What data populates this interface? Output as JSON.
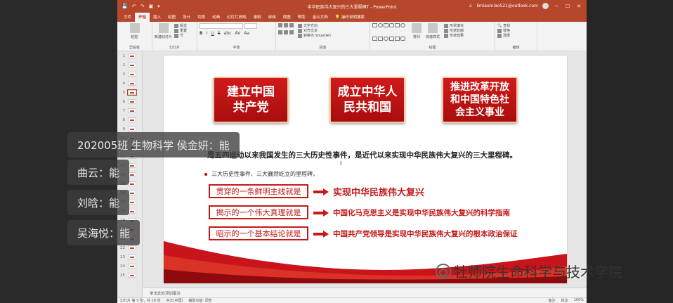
{
  "window": {
    "title": "中华民族伟大复兴的三大里程碑T - PowerPoint",
    "account": "limiaomiao521@outlook.com",
    "quick_access": [
      "💾",
      "↶",
      "↷",
      "▣",
      "▾"
    ],
    "controls": [
      "─",
      "☐",
      "✕"
    ]
  },
  "tabs": [
    "文件",
    "开始",
    "插入",
    "绘图",
    "设计",
    "切换",
    "动画",
    "幻灯片放映",
    "录制",
    "审阅",
    "视图",
    "帮助",
    "金山文档",
    "操作说明搜索"
  ],
  "active_tab": "开始",
  "ribbon": {
    "groups": [
      {
        "label": "剪贴板",
        "items": [
          "粘贴"
        ]
      },
      {
        "label": "幻灯片",
        "items": [
          "新建幻灯片",
          "版式",
          "重置",
          "节"
        ]
      },
      {
        "label": "字体",
        "items": [
          "B",
          "I",
          "U",
          "S",
          "abc",
          "AV",
          "Aa"
        ]
      },
      {
        "label": "段落",
        "items": [
          "文字方向",
          "对齐文本",
          "转换为 SmartArt"
        ]
      },
      {
        "label": "绘图",
        "items": [
          "排列",
          "快速样式",
          "形状填充",
          "形状轮廓",
          "形状效果"
        ]
      },
      {
        "label": "编辑",
        "items": [
          "查找",
          "替换",
          "选择"
        ]
      }
    ]
  },
  "thumbnails": {
    "numbers": [
      "1",
      "2",
      "3",
      "4",
      "5",
      "6",
      "7",
      "8",
      "9",
      "10",
      "11",
      "12",
      "13",
      "14",
      "15",
      "16",
      "17",
      "18",
      "19",
      "20",
      "21",
      "22",
      "23",
      "24",
      "25"
    ],
    "selected": "5"
  },
  "slide": {
    "boxes": [
      {
        "text": "建立中国\n共产党"
      },
      {
        "text": "成立中华人\n民共和国"
      },
      {
        "text": "推进改革开放\n和中国特色社\n会主义事业"
      }
    ],
    "main_line": "是五四运动以来我国发生的三大历史性事件，是近代以来实现中华民族伟大复兴的三大里程碑。",
    "bullet": "三大历史性事件、三大巍然屹立的里程碑，",
    "rows": [
      {
        "label": "贯穿的一条鲜明主线就是",
        "text": "实现中华民族伟大复兴"
      },
      {
        "label": "揭示的一个伟大真理就是",
        "text": "中国化马克思主义是实现中华民族伟大复兴的科学指南"
      },
      {
        "label": "昭示的一个基本结论就是",
        "text": "中国共产党领导是实现中华民族伟大复兴的根本政治保证"
      }
    ]
  },
  "notes_placeholder": "单击此处添加备注",
  "status": {
    "slide_info": "幻灯片 第 5 张，共 28 张",
    "language": "中文(中国)",
    "accessibility": "辅助功能: 调查",
    "notes": "备注",
    "comments": "批注",
    "zoom": "100%"
  },
  "chat": [
    {
      "text": "202005班 生物科学 侯金妍：能"
    },
    {
      "text": "曲云：能"
    },
    {
      "text": "刘晗：能"
    },
    {
      "text": "吴海悦：能"
    }
  ],
  "watermark": "牡师院生命科学与技术学院",
  "colors": {
    "accent": "#b7472a",
    "slide_red": "#c41a1a"
  }
}
